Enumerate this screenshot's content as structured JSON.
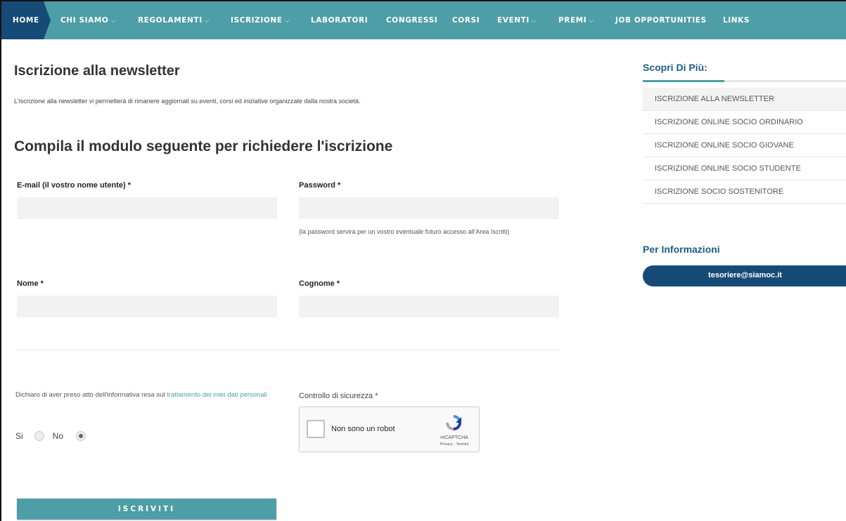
{
  "nav": {
    "home": "HOME",
    "items": [
      {
        "label": "CHI SIAMO",
        "caret": "⌵"
      },
      {
        "label": "REGOLAMENTI",
        "caret": "⌵"
      },
      {
        "label": "ISCRIZIONE",
        "caret": "⌵"
      },
      {
        "label": "LABORATORI",
        "caret": ""
      },
      {
        "label": "CONGRESSI",
        "caret": ""
      },
      {
        "label": "CORSI",
        "caret": ""
      },
      {
        "label": "EVENTI",
        "caret": "⌵"
      },
      {
        "label": "PREMI",
        "caret": "⌵"
      },
      {
        "label": "JOB OPPORTUNITIES",
        "caret": ""
      },
      {
        "label": "LINKS",
        "caret": ""
      }
    ]
  },
  "main": {
    "title": "Iscrizione alla newsletter",
    "intro": "L'iscrizione alla newsletter vi permetterà di rimanere aggiornati su eventi, corsi ed iniziative organizzate dalla nostra società.",
    "form_title": "Compila il modulo seguente per richiedere l'iscrizione",
    "fields": {
      "email_label": "E-mail (il vostro nome utente) *",
      "email_value": "",
      "password_label": "Password *",
      "password_value": "",
      "password_hint": "(la password servirà per un vostro eventuale futuro accesso all'Area Iscritti)",
      "nome_label": "Nome *",
      "nome_value": "",
      "cognome_label": "Cognome *",
      "cognome_value": ""
    },
    "privacy": {
      "text": "Dichiaro di aver preso atto dell'informativa resa sul ",
      "link": "trattamento dei miei dati personali",
      "yes_label": "Si",
      "no_label": "No",
      "selected": "No"
    },
    "captcha": {
      "label": "Controllo di sicurezza *",
      "text": "Non sono un robot",
      "brand": "reCAPTCHA",
      "links": "Privacy - Termini"
    },
    "submit_label": "ISCRIVITI"
  },
  "sidebar": {
    "title": "Scopri Di Più:",
    "items": [
      {
        "label": "ISCRIZIONE ALLA NEWSLETTER",
        "active": true
      },
      {
        "label": "ISCRIZIONE ONLINE SOCIO ORDINARIO",
        "active": false
      },
      {
        "label": "ISCRIZIONE ONLINE SOCIO GIOVANE",
        "active": false
      },
      {
        "label": "ISCRIZIONE ONLINE SOCIO STUDENTE",
        "active": false
      },
      {
        "label": "ISCRIZIONE SOCIO SOSTENITORE",
        "active": false
      }
    ],
    "info_title": "Per Informazioni",
    "info_email": "tesoriere@siamoc.it"
  },
  "colors": {
    "teal": "#4e9ea7",
    "navy": "#164b77",
    "heading_blue": "#1d5c85"
  }
}
